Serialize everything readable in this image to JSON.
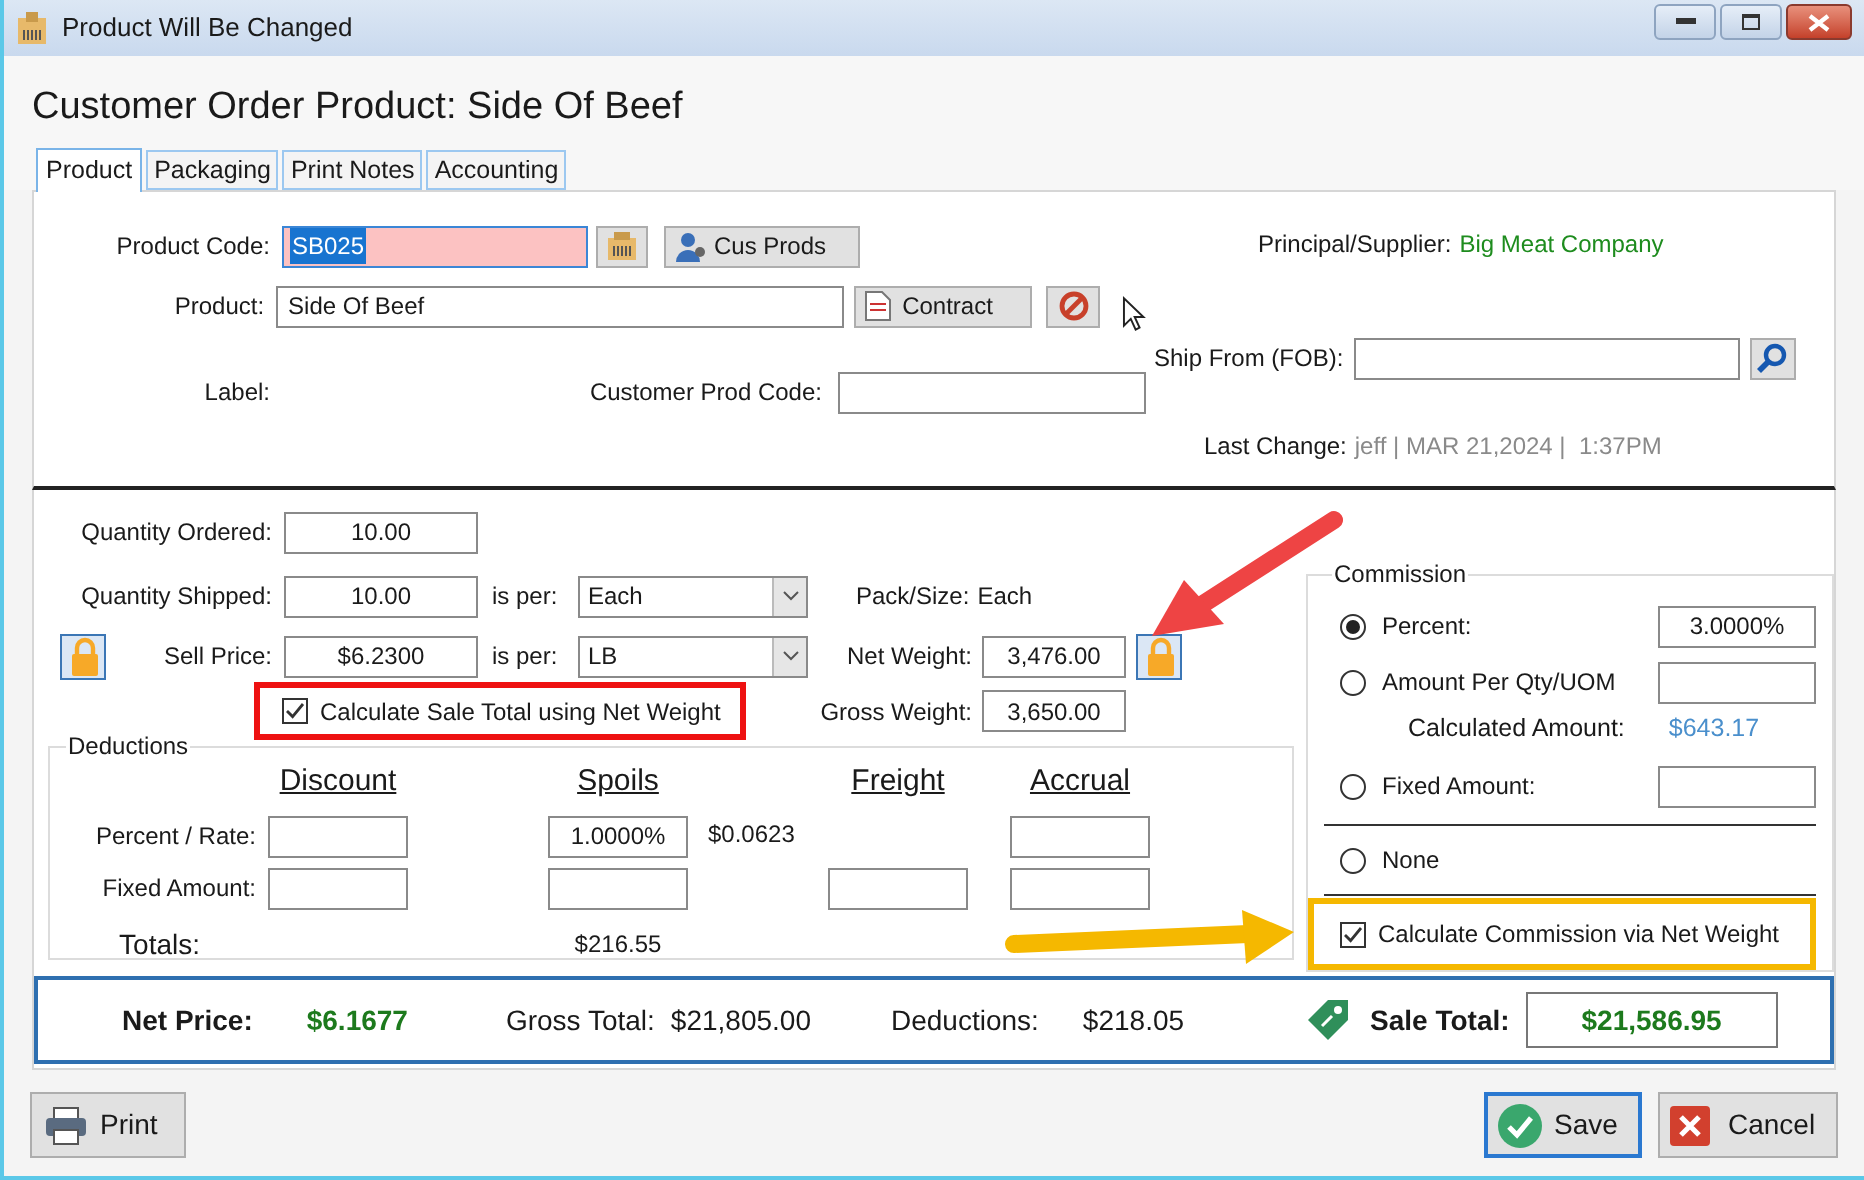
{
  "window": {
    "title": "Product Will Be Changed"
  },
  "heading": "Customer Order Product: Side Of Beef",
  "tabs": [
    {
      "label": "Product",
      "selected": true
    },
    {
      "label": "Packaging",
      "selected": false
    },
    {
      "label": "Print Notes",
      "selected": false
    },
    {
      "label": "Accounting",
      "selected": false
    }
  ],
  "product": {
    "code_label": "Product Code:",
    "code": "SB025",
    "cus_prods_button": "Cus Prods",
    "product_label": "Product:",
    "product": "Side Of Beef",
    "contract_button": "Contract",
    "label_label": "Label:",
    "customer_prod_code_label": "Customer Prod Code:",
    "supplier_label": "Principal/Supplier:",
    "supplier": "Big Meat Company",
    "ship_from_label": "Ship From (FOB):",
    "last_change_label": "Last Change:",
    "last_change": "jeff | MAR 21,2024 |  1:37PM"
  },
  "quantities": {
    "ordered_label": "Quantity Ordered:",
    "ordered": "10.00",
    "shipped_label": "Quantity Shipped:",
    "shipped": "10.00",
    "shipped_per_label": "is per:",
    "shipped_per": "Each",
    "pack_size_label": "Pack/Size:",
    "pack_size": "Each",
    "sell_price_label": "Sell Price:",
    "sell_price": "$6.2300",
    "price_per_label": "is per:",
    "price_per": "LB",
    "net_weight_label": "Net Weight:",
    "net_weight": "3,476.00",
    "gross_weight_label": "Gross Weight:",
    "gross_weight": "3,650.00",
    "net_weight_checkbox": {
      "label": "Calculate Sale Total using Net Weight",
      "checked": true
    }
  },
  "deductions": {
    "title": "Deductions",
    "columns": [
      "Discount",
      "Spoils",
      "Freight",
      "Accrual"
    ],
    "rows": [
      {
        "label": "Percent / Rate:",
        "cells": [
          {
            "kind": "field"
          },
          {
            "kind": "field",
            "value": "1.0000%",
            "note": "$0.0623"
          },
          {
            "kind": "none"
          },
          {
            "kind": "field"
          }
        ]
      },
      {
        "label": "Fixed Amount:",
        "cells": [
          {
            "kind": "field"
          },
          {
            "kind": "field"
          },
          {
            "kind": "field"
          },
          {
            "kind": "field"
          }
        ]
      },
      {
        "label": "Totals:",
        "cells": [
          {
            "kind": "none"
          },
          {
            "kind": "text",
            "value": "$216.55"
          },
          {
            "kind": "none"
          },
          {
            "kind": "none"
          }
        ]
      }
    ]
  },
  "commission": {
    "title": "Commission",
    "items": [
      {
        "kind": "radio-field",
        "label": "Percent:",
        "selected": true,
        "value": "3.0000%"
      },
      {
        "kind": "radio-field",
        "label": "Amount Per Qty/UOM",
        "selected": false
      },
      {
        "kind": "info",
        "label": "Calculated Amount:",
        "value": "$643.17"
      },
      {
        "kind": "radio-field",
        "label": "Fixed Amount:",
        "selected": false
      },
      {
        "kind": "radio",
        "label": "None",
        "selected": false
      }
    ],
    "net_weight_checkbox": {
      "label": "Calculate Commission via Net Weight",
      "checked": true
    }
  },
  "totals": {
    "net_price_label": "Net Price:",
    "net_price": "$6.1677",
    "gross_total_label": "Gross Total:",
    "gross_total": "$21,805.00",
    "deductions_label": "Deductions:",
    "deductions": "$218.05",
    "sale_total_label": "Sale Total:",
    "sale_total": "$21,586.95"
  },
  "buttons": {
    "print": "Print",
    "save": "Save",
    "cancel": "Cancel"
  }
}
